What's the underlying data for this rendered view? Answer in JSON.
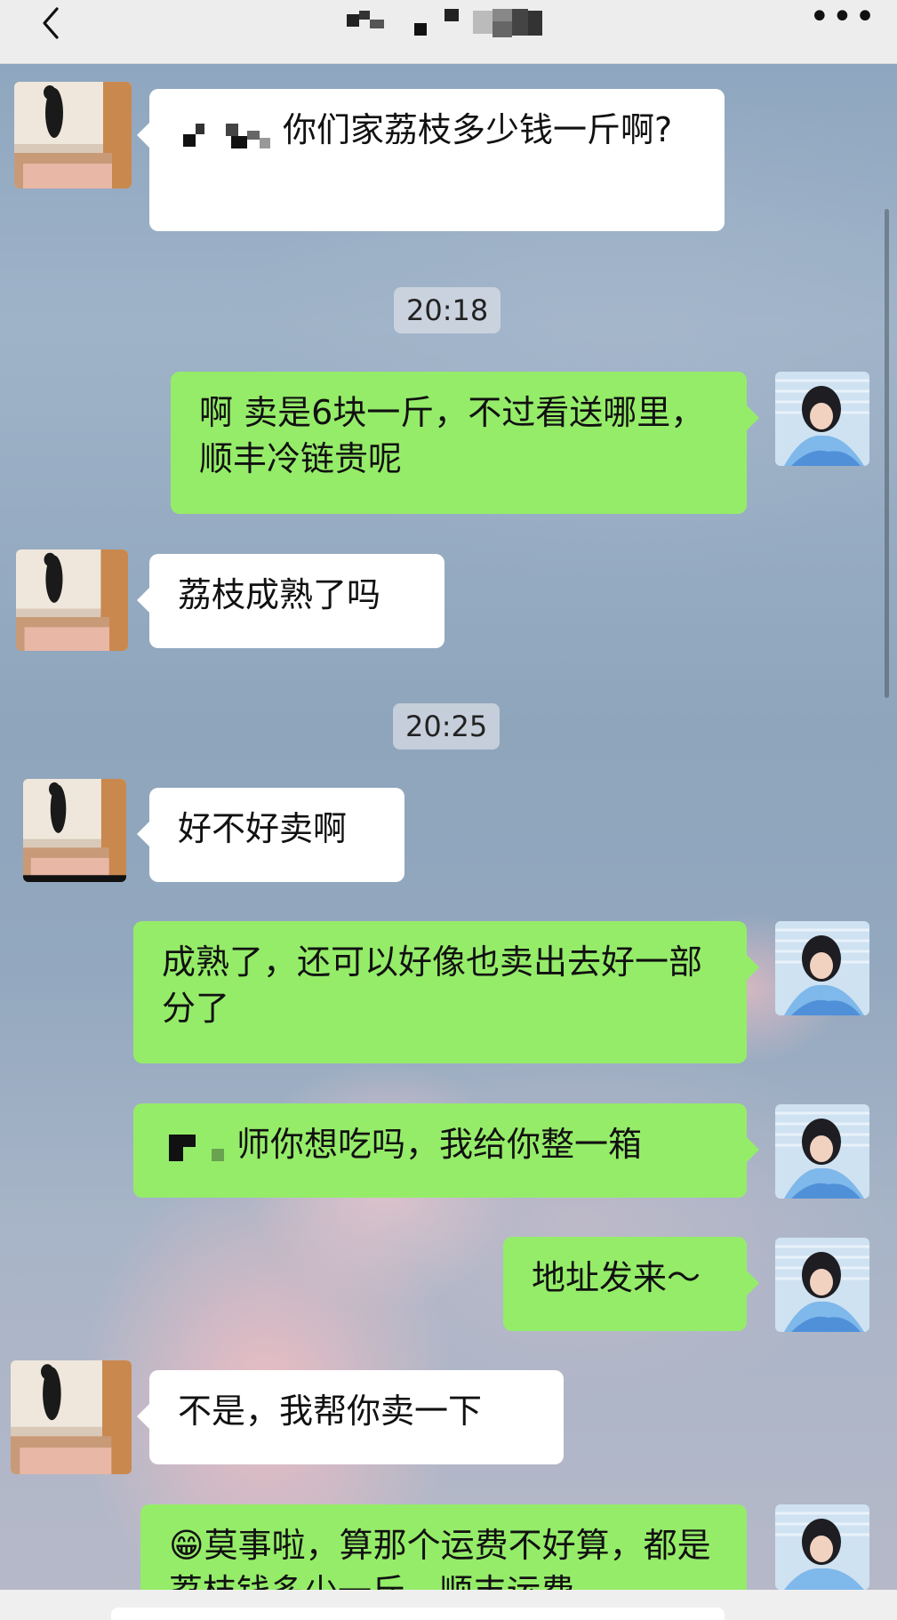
{
  "header": {
    "back_icon": "chevron-left-icon",
    "title_mosaic": "pixelated-contact-name",
    "more_icon": "more-dots-icon",
    "more_label": "•••"
  },
  "messages": [
    {
      "side": "in",
      "text": "你们家荔枝多少钱一斤啊?",
      "mosaic_prefix": true
    },
    {
      "type": "time",
      "text": "20:18"
    },
    {
      "side": "out",
      "text": "啊 卖是6块一斤，不过看送哪里，顺丰冷链贵呢"
    },
    {
      "side": "in",
      "text": "荔枝成熟了吗"
    },
    {
      "type": "time",
      "text": "20:25"
    },
    {
      "side": "in",
      "text": "好不好卖啊"
    },
    {
      "side": "out",
      "text": "成熟了，还可以好像也卖出去好一部分了"
    },
    {
      "side": "out",
      "text": "师你想吃吗，我给你整一箱",
      "mosaic_prefix": true
    },
    {
      "side": "out",
      "text": "地址发来～"
    },
    {
      "side": "in",
      "text": "不是，我帮你卖一下"
    },
    {
      "side": "out",
      "text": "😁莫事啦，算那个运费不好算，都是荔枝钱多少一斤，顺丰运费"
    }
  ],
  "colors": {
    "outgoing_bubble": "#95ec69",
    "incoming_bubble": "#ffffff",
    "timestamp_bg": "#d7dce4"
  }
}
